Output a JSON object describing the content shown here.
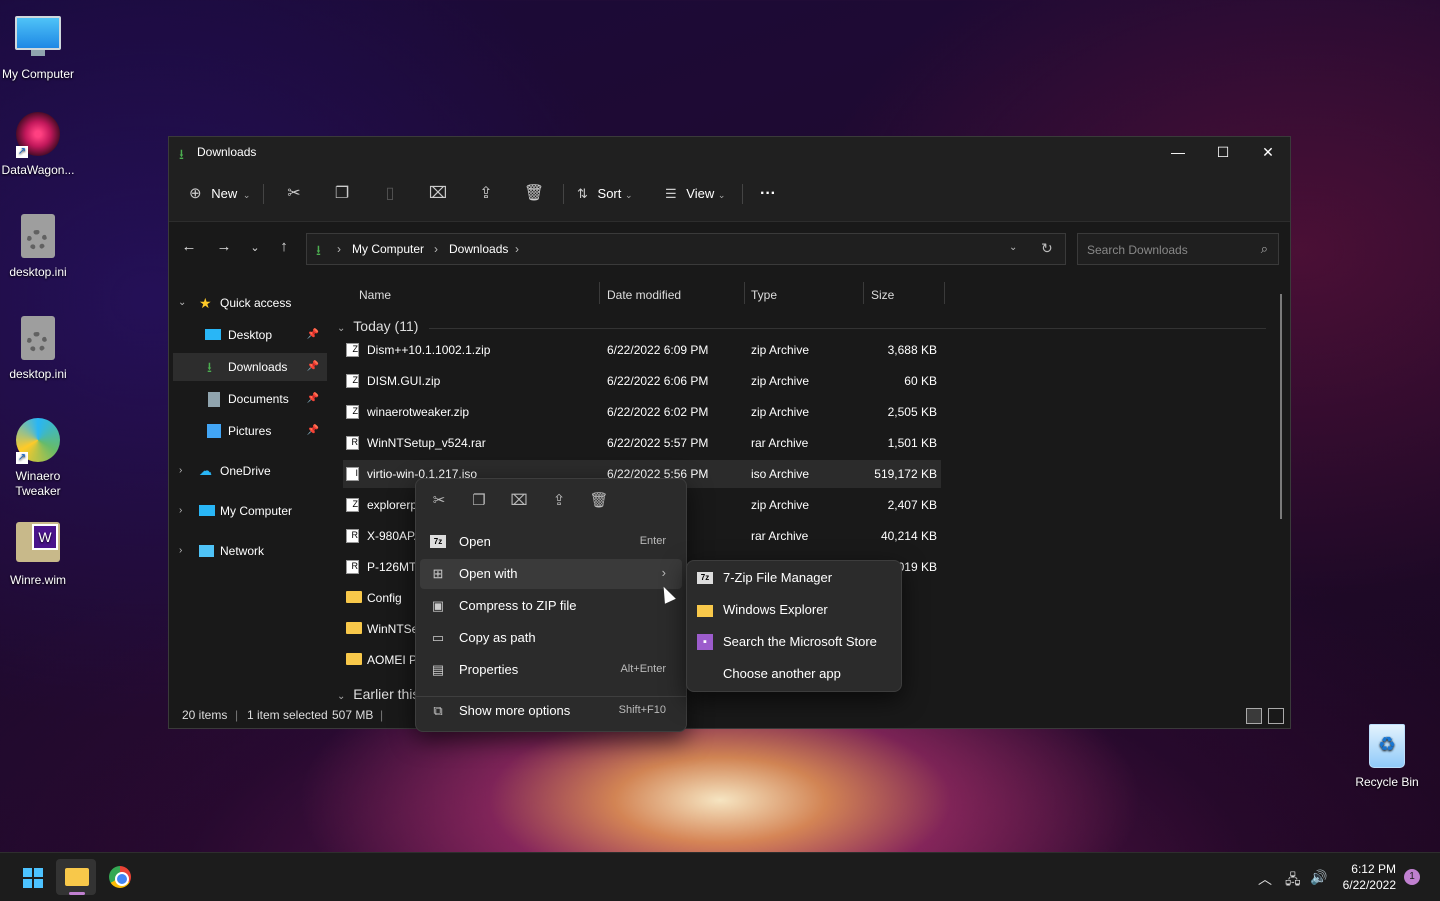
{
  "desktop": {
    "icons": [
      {
        "label": "My Computer"
      },
      {
        "label": "DataWagon..."
      },
      {
        "label": "desktop.ini"
      },
      {
        "label": "desktop.ini"
      },
      {
        "label": "Winaero Tweaker"
      },
      {
        "label": "Winre.wim"
      },
      {
        "label": "Recycle Bin"
      }
    ]
  },
  "window": {
    "title": "Downloads",
    "controls": {
      "minimize": "—",
      "maximize": "☐",
      "close": "✕"
    }
  },
  "toolbar": {
    "new_label": "New",
    "sort_label": "Sort",
    "view_label": "View",
    "more_label": "···"
  },
  "address": {
    "crumbs": [
      "My Computer",
      "Downloads"
    ],
    "search_placeholder": "Search Downloads"
  },
  "nav": {
    "quick_access": "Quick access",
    "items": [
      {
        "label": "Desktop"
      },
      {
        "label": "Downloads"
      },
      {
        "label": "Documents"
      },
      {
        "label": "Pictures"
      }
    ],
    "onedrive": "OneDrive",
    "my_computer": "My Computer",
    "network": "Network"
  },
  "columns": {
    "name": "Name",
    "date": "Date modified",
    "type": "Type",
    "size": "Size"
  },
  "groups": {
    "today": "Today (11)",
    "earlier": "Earlier this"
  },
  "files": [
    {
      "name": "Dism++10.1.1002.1.zip",
      "date": "6/22/2022 6:09 PM",
      "type": "zip Archive",
      "size": "3,688 KB",
      "icon": "Z"
    },
    {
      "name": "DISM.GUI.zip",
      "date": "6/22/2022 6:06 PM",
      "type": "zip Archive",
      "size": "60 KB",
      "icon": "Z"
    },
    {
      "name": "winaerotweaker.zip",
      "date": "6/22/2022 6:02 PM",
      "type": "zip Archive",
      "size": "2,505 KB",
      "icon": "Z"
    },
    {
      "name": "WinNTSetup_v524.rar",
      "date": "6/22/2022 5:57 PM",
      "type": "rar Archive",
      "size": "1,501 KB",
      "icon": "R"
    },
    {
      "name": "virtio-win-0.1.217.iso",
      "date": "6/22/2022 5:56 PM",
      "type": "iso Archive",
      "size": "519,172 KB",
      "icon": "I"
    },
    {
      "name": "explorerp",
      "date": "PM",
      "type": "zip Archive",
      "size": "2,407 KB",
      "icon": "Z"
    },
    {
      "name": "X-980APA",
      "date": "PM",
      "type": "rar Archive",
      "size": "40,214 KB",
      "icon": "R"
    },
    {
      "name": "P-126MTI",
      "date": "",
      "type": "",
      "size": "019 KB",
      "icon": "R"
    },
    {
      "name": "Config",
      "date": "",
      "type": "",
      "size": "",
      "icon": "folder"
    },
    {
      "name": "WinNTSe",
      "date": "",
      "type": "",
      "size": "",
      "icon": "folder"
    },
    {
      "name": "AOMEI Pa",
      "date": "",
      "type": "",
      "size": "",
      "icon": "folder"
    }
  ],
  "status": {
    "items": "20 items",
    "selected": "1 item selected",
    "size": "507 MB"
  },
  "context_menu": {
    "items": [
      {
        "label": "Open",
        "shortcut": "Enter",
        "icon": "7z-icon"
      },
      {
        "label": "Open with",
        "shortcut": "",
        "icon": "open-with-icon"
      },
      {
        "label": "Compress to ZIP file",
        "shortcut": "",
        "icon": "zip-icon"
      },
      {
        "label": "Copy as path",
        "shortcut": "",
        "icon": "path-icon"
      },
      {
        "label": "Properties",
        "shortcut": "Alt+Enter",
        "icon": "properties-icon"
      },
      {
        "label": "Show more options",
        "shortcut": "Shift+F10",
        "icon": "more-options-icon"
      }
    ],
    "submenu": [
      {
        "label": "7-Zip File Manager"
      },
      {
        "label": "Windows Explorer"
      },
      {
        "label": "Search the Microsoft Store"
      },
      {
        "label": "Choose another app"
      }
    ]
  },
  "taskbar": {
    "time": "6:12 PM",
    "date": "6/22/2022",
    "notifications": "1"
  },
  "colors": {
    "accent": "#4cc2ff",
    "folder": "#f8c84a",
    "download_green": "#4caf50"
  }
}
